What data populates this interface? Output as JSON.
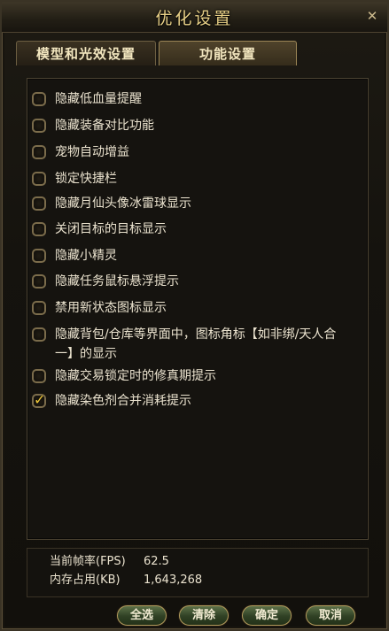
{
  "window": {
    "title": "优化设置",
    "close_glyph": "✕"
  },
  "tabs": [
    {
      "label": "模型和光效设置",
      "active": false
    },
    {
      "label": "功能设置",
      "active": true
    }
  ],
  "options": [
    {
      "label": "隐藏低血量提醒",
      "checked": false
    },
    {
      "label": "隐藏装备对比功能",
      "checked": false
    },
    {
      "label": "宠物自动增益",
      "checked": false
    },
    {
      "label": "锁定快捷栏",
      "checked": false
    },
    {
      "label": "隐藏月仙头像冰雷球显示",
      "checked": false
    },
    {
      "label": "关闭目标的目标显示",
      "checked": false
    },
    {
      "label": "隐藏小精灵",
      "checked": false
    },
    {
      "label": "隐藏任务鼠标悬浮提示",
      "checked": false
    },
    {
      "label": "禁用新状态图标显示",
      "checked": false
    },
    {
      "label": "隐藏背包/仓库等界面中，图标角标【如非绑/天人合一】的显示",
      "checked": false
    },
    {
      "label": "隐藏交易锁定时的修真期提示",
      "checked": false
    },
    {
      "label": "隐藏染色剂合并消耗提示",
      "checked": true
    }
  ],
  "stats": {
    "fps_label": "当前帧率(FPS)",
    "fps_value": "62.5",
    "memory_label": "内存占用(KB)",
    "memory_value": "1,643,268"
  },
  "buttons": {
    "select_all": "全选",
    "clear": "清除",
    "confirm": "确定",
    "cancel": "取消"
  },
  "check_glyph": "✓"
}
